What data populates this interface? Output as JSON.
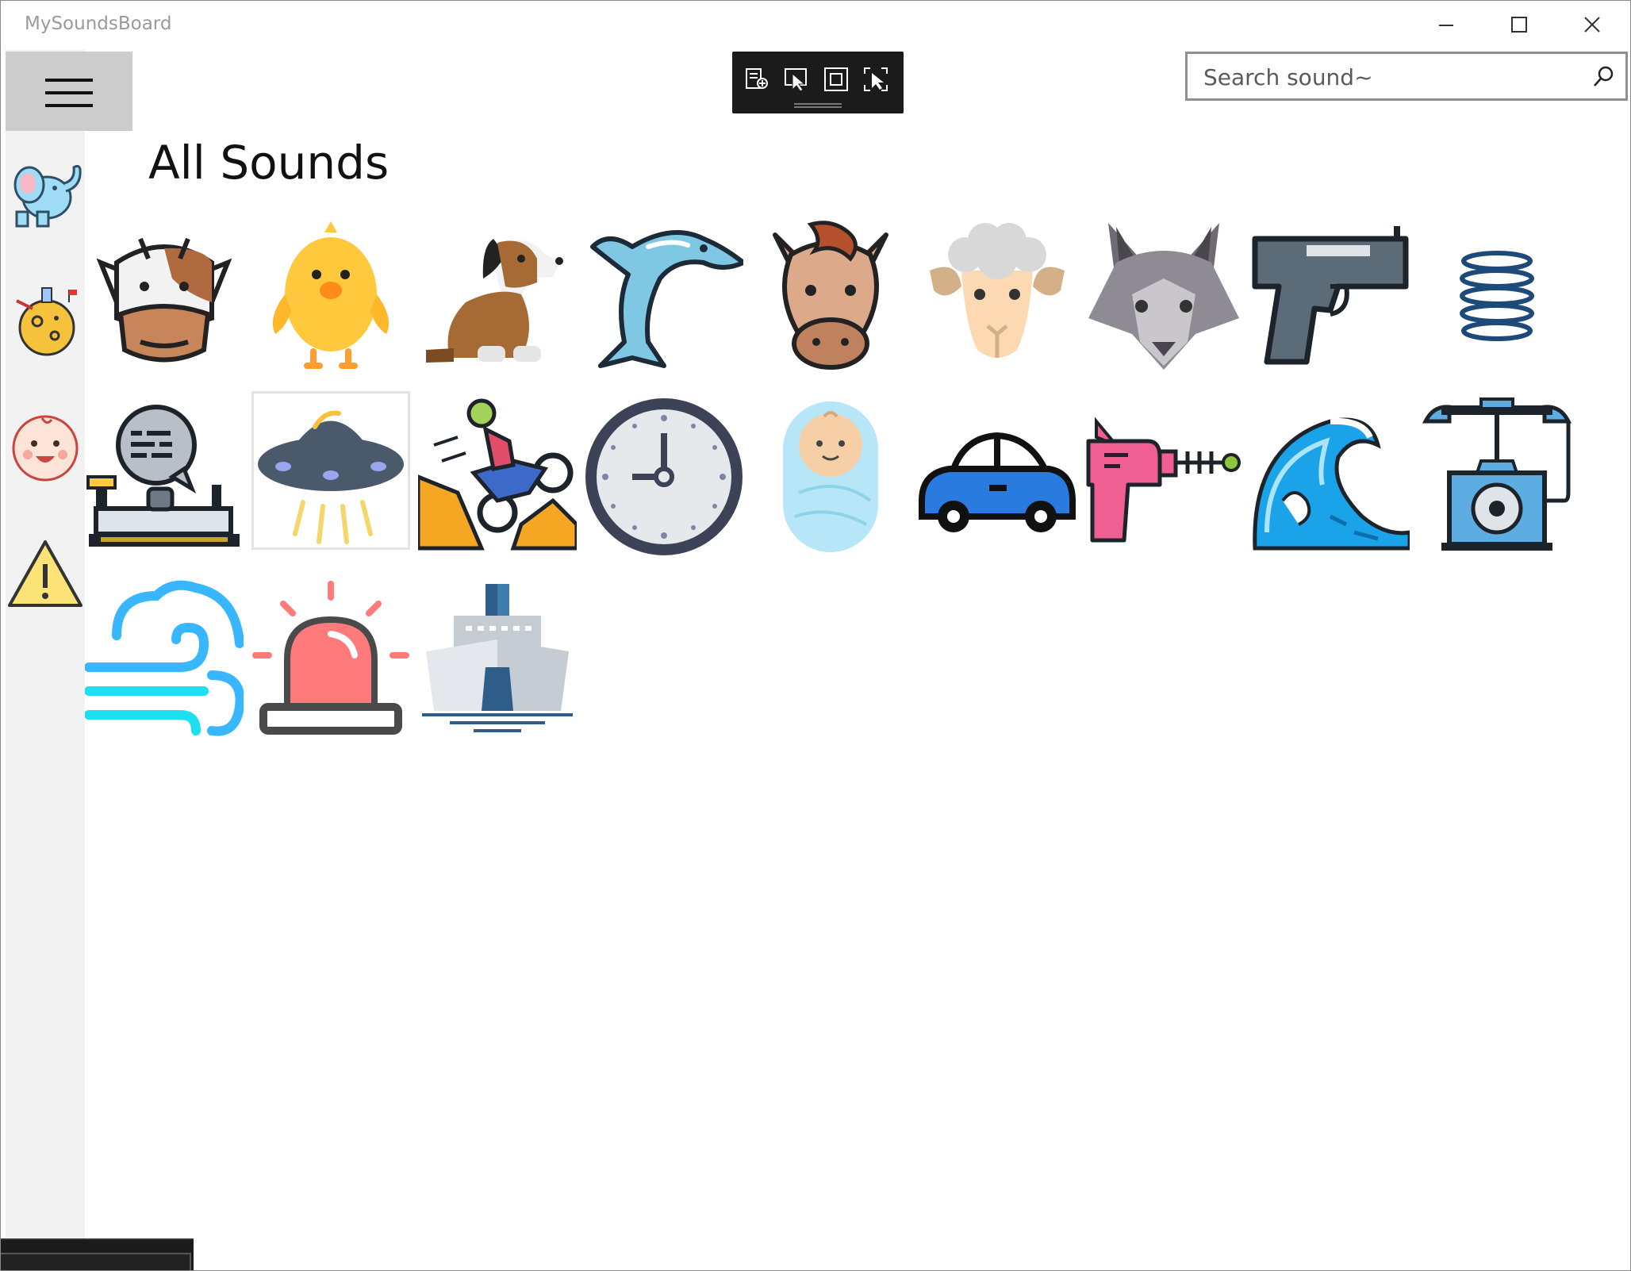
{
  "window": {
    "title": "MySoundsBoard",
    "minimize_label": "minimize",
    "maximize_label": "maximize",
    "close_label": "close"
  },
  "search": {
    "placeholder": "Search sound~",
    "value": ""
  },
  "page": {
    "title": "All Sounds"
  },
  "nav": {
    "items": [
      {
        "icon": "elephant-icon"
      },
      {
        "icon": "moon-planet-icon"
      },
      {
        "icon": "baby-face-icon"
      },
      {
        "icon": "warning-icon"
      }
    ]
  },
  "sounds": [
    {
      "icon": "cow-icon"
    },
    {
      "icon": "chick-icon"
    },
    {
      "icon": "dog-icon"
    },
    {
      "icon": "dolphin-icon"
    },
    {
      "icon": "horse-icon"
    },
    {
      "icon": "sheep-icon"
    },
    {
      "icon": "wolf-icon"
    },
    {
      "icon": "pistol-icon"
    },
    {
      "icon": "spring-icon"
    },
    {
      "icon": "telegraph-icon"
    },
    {
      "icon": "ufo-icon",
      "selected": true
    },
    {
      "icon": "motocross-icon"
    },
    {
      "icon": "clock-icon"
    },
    {
      "icon": "swaddled-baby-icon"
    },
    {
      "icon": "car-icon"
    },
    {
      "icon": "ray-gun-icon"
    },
    {
      "icon": "wave-icon"
    },
    {
      "icon": "rotary-telephone-icon"
    },
    {
      "icon": "wind-icon"
    },
    {
      "icon": "siren-icon"
    },
    {
      "icon": "ship-icon"
    }
  ],
  "colors": {
    "pane": "#f2f2f2",
    "hamburger_bg": "#cccccc",
    "debug_toolbar": "#1b1b1b"
  }
}
